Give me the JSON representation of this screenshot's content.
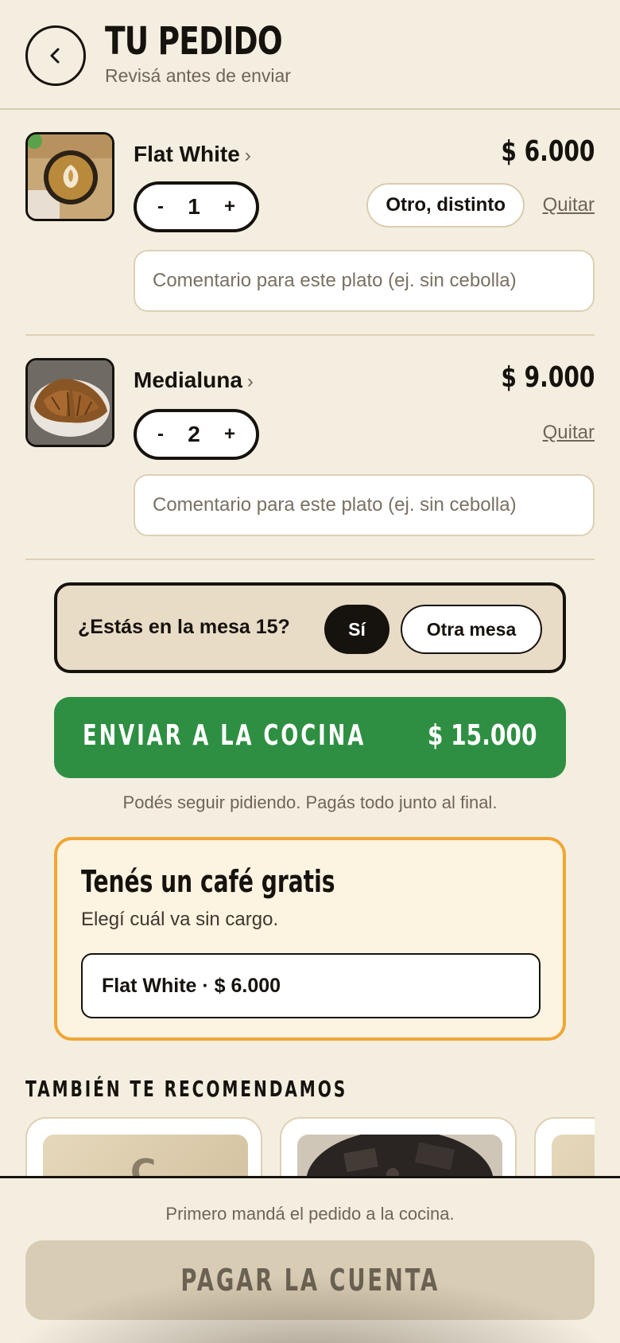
{
  "header": {
    "title": "TU PEDIDO",
    "subtitle": "Revisá antes de enviar"
  },
  "items": [
    {
      "name": "Flat White",
      "price": "$ 6.000",
      "qty": "1",
      "minus": "-",
      "plus": "+",
      "variant": "Otro, distinto",
      "remove": "Quitar",
      "comment_placeholder": "Comentario para este plato (ej. sin cebolla)"
    },
    {
      "name": "Medialuna",
      "price": "$ 9.000",
      "qty": "2",
      "minus": "-",
      "plus": "+",
      "remove": "Quitar",
      "comment_placeholder": "Comentario para este plato (ej. sin cebolla)"
    }
  ],
  "table_confirm": {
    "question": "¿Estás en la mesa 15?",
    "yes": "Sí",
    "other": "Otra mesa"
  },
  "send": {
    "label": "ENVIAR A LA COCINA",
    "total": "$ 15.000",
    "note": "Podés seguir pidiendo. Pagás todo junto al final."
  },
  "free_coffee": {
    "title": "Tenés un café gratis",
    "subtitle": "Elegí cuál va sin cargo.",
    "selected": "Flat White · $ 6.000"
  },
  "recommendations": {
    "title": "TAMBIÉN TE RECOMENDAMOS",
    "first_card_letter": "C"
  },
  "bottom": {
    "note": "Primero mandá el pedido a la cocina.",
    "pay_label": "PAGAR LA CUENTA"
  },
  "colors": {
    "background": "#f4eee1",
    "send_green": "#2e8f42",
    "free_border": "#f0a634",
    "ink": "#16120d"
  }
}
